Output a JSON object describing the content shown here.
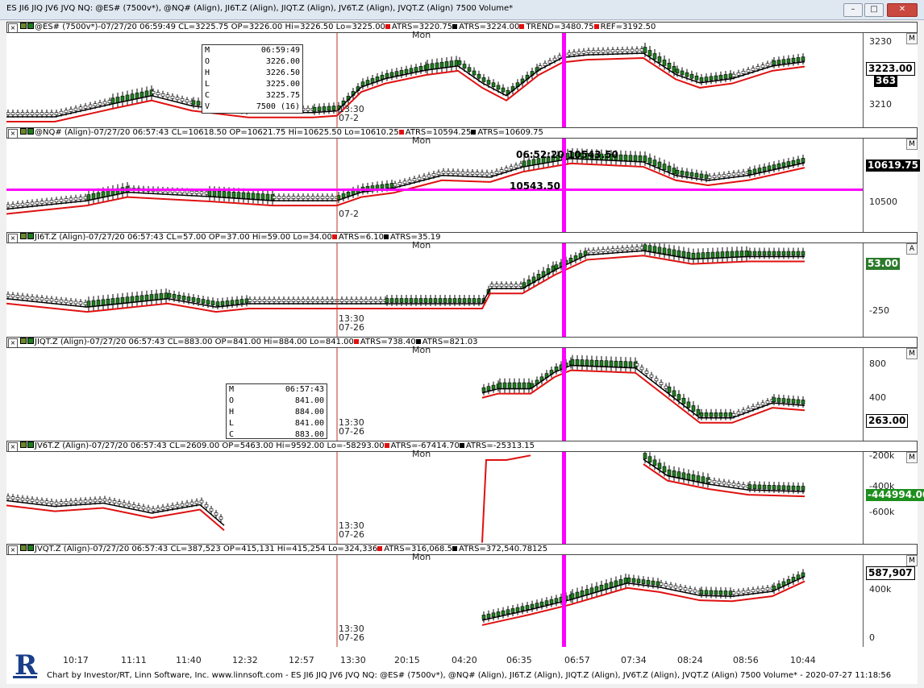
{
  "window": {
    "title": "ES JI6 JIQ JV6 JVQ NQ: @ES# (7500v*), @NQ# (Align), JI6T.Z (Align), JIQT.Z (Align), JV6T.Z (Align), JVQT.Z (Align) 7500 Volume*",
    "min": "–",
    "max": "□",
    "close": "✕"
  },
  "colors": {
    "up": "#1e7d1e",
    "down": "#000000",
    "red": "#e01010",
    "magenta": "#ff00ff",
    "vline": "#c0302a"
  },
  "panels": [
    {
      "id": "es",
      "header": "@ES# (7500v*)-07/27/20 06:59:49 CL=3225.75 OP=3226.00 Hi=3226.50 Lo=3225.00",
      "ind": [
        "ATRS=3220.75",
        "ATRS=3224.00",
        "TREND=3480.75",
        "REF=3192.50"
      ],
      "ind_colors": [
        "red",
        "black",
        "red",
        "red"
      ],
      "btn": "M",
      "mon": "Mon",
      "yticks": [
        "3230",
        "3220",
        "3210"
      ],
      "tag": "3223.00",
      "tag2": "363",
      "session": [
        "13:30",
        "07-2"
      ],
      "ohlc": {
        "M": "06:59:49",
        "O": "3226.00",
        "H": "3226.50",
        "L": "3225.00",
        "C": "3225.75",
        "V": "7500 (16)"
      }
    },
    {
      "id": "nq",
      "header": "@NQ# (Align)-07/27/20 06:57:43 CL=10618.50 OP=10621.75 Hi=10625.50 Lo=10610.25",
      "ind": [
        "ATRS=10594.25",
        "ATRS=10609.75"
      ],
      "ind_colors": [
        "red",
        "black"
      ],
      "btn": "M",
      "mon": "Mon",
      "yticks": [
        "10500"
      ],
      "tag": "10619.75",
      "session": [
        "07-2"
      ],
      "annot_top": "06:52:20  10543.50",
      "annot_line": "10543.50"
    },
    {
      "id": "ji6",
      "header": "JI6T.Z (Align)-07/27/20 06:57:43 CL=57.00 OP=37.00 Hi=59.00 Lo=34.00",
      "ind": [
        "ATRS=6.10",
        "ATRS=35.19"
      ],
      "ind_colors": [
        "red",
        "black"
      ],
      "btn": "A",
      "mon": "Mon",
      "yticks": [
        "0",
        "-250"
      ],
      "tag": "53.00",
      "session": [
        "13:30",
        "07-26"
      ]
    },
    {
      "id": "jiq",
      "header": "JIQT.Z (Align)-07/27/20 06:57:43 CL=883.00 OP=841.00 Hi=884.00 Lo=841.00",
      "ind": [
        "ATRS=738.40",
        "ATRS=821.03"
      ],
      "ind_colors": [
        "red",
        "black"
      ],
      "btn": "M",
      "mon": "Mon",
      "yticks": [
        "800",
        "400"
      ],
      "tag": "263.00",
      "session": [
        "13:30",
        "07-26"
      ],
      "ohlc": {
        "M": "06:57:43",
        "O": "841.00",
        "H": "884.00",
        "L": "841.00",
        "C": "883.00"
      }
    },
    {
      "id": "jv6",
      "header": "JV6T.Z (Align)-07/27/20 06:57:43 CL=2609.00 OP=5463.00 Hi=9592.00 Lo=-58293.00",
      "ind": [
        "ATRS=-67414.70",
        "ATRS=-25313.15"
      ],
      "ind_colors": [
        "red",
        "black"
      ],
      "btn": "M",
      "mon": "Mon",
      "yticks": [
        "-200k",
        "-400k",
        "-600k"
      ],
      "tag": "-444994.00",
      "session": [
        "13:30",
        "07-26"
      ]
    },
    {
      "id": "jvq",
      "header": "JVQT.Z (Align)-07/27/20 06:57:43 CL=387,523 OP=415,131 Hi=415,254 Lo=324,336",
      "ind": [
        "ATRS=316,068.5",
        "ATRS=372,540.78125"
      ],
      "ind_colors": [
        "red",
        "black"
      ],
      "btn": "M",
      "mon": "Mon",
      "yticks": [
        "400k",
        "0"
      ],
      "tag": "587,907",
      "session": [
        "13:30",
        "07-26"
      ]
    }
  ],
  "xaxis": [
    "10:17",
    "11:11",
    "11:40",
    "12:32",
    "12:57",
    "13:30",
    "20:15",
    "04:20",
    "06:35",
    "06:57",
    "07:34",
    "08:24",
    "08:56",
    "10:44"
  ],
  "footer": "Chart by Investor/RT, Linn Software, Inc. www.linnsoft.com - ES JI6 JIQ JV6 JVQ NQ: @ES# (7500v*), @NQ# (Align), JI6T.Z (Align), JIQT.Z (Align), JV6T.Z (Align), JVQT.Z (Align) 7500 Volume* - 2020-07-27 11:18:56"
}
